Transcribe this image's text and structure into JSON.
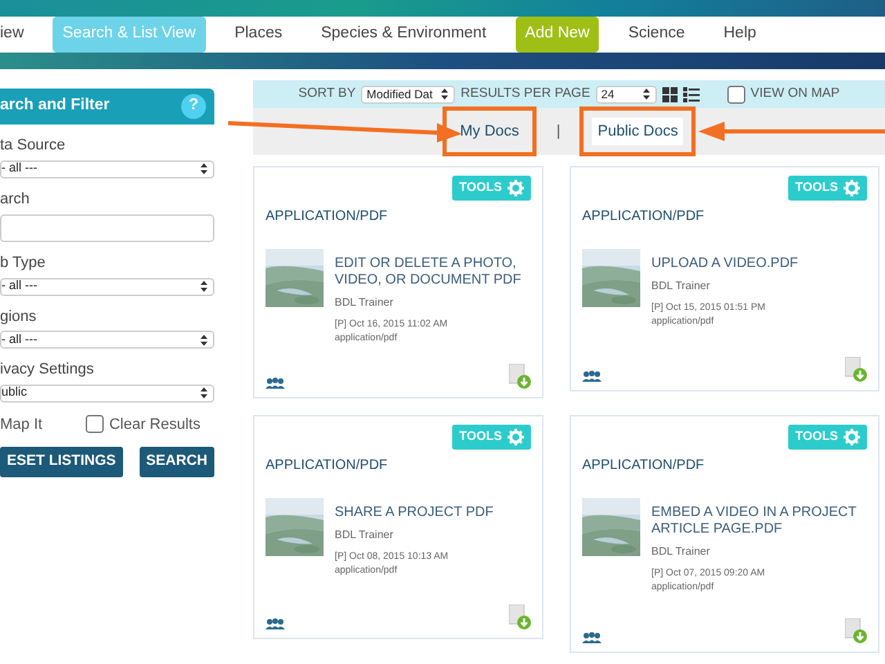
{
  "nav": {
    "items": [
      {
        "label": "iew",
        "kind": "link",
        "selected": false
      },
      {
        "label": "Search & List View",
        "kind": "link",
        "selected": true
      },
      {
        "label": "Places",
        "kind": "link",
        "selected": false
      },
      {
        "label": "Species & Environment",
        "kind": "link",
        "selected": false
      },
      {
        "label": "Add New",
        "kind": "action",
        "selected": false
      },
      {
        "label": "Science",
        "kind": "link",
        "selected": false
      },
      {
        "label": "Help",
        "kind": "link",
        "selected": false
      }
    ]
  },
  "sidebar": {
    "title": "arch and Filter",
    "help": "?",
    "fields": [
      {
        "kind": "select",
        "label": "ta Source",
        "value": "- all ---"
      },
      {
        "kind": "text",
        "label": "arch"
      },
      {
        "kind": "select",
        "label": "b Type",
        "value": "- all ---"
      },
      {
        "kind": "select",
        "label": "gions",
        "value": "- all ---"
      },
      {
        "kind": "select",
        "label": "ivacy Settings",
        "value": "ublic"
      }
    ],
    "checkboxes": [
      {
        "label": "Map It"
      },
      {
        "label": "Clear Results",
        "checked": false
      }
    ],
    "buttons": [
      "ESET LISTINGS",
      "SEARCH"
    ]
  },
  "toolbar": {
    "sort_label": "SORT BY",
    "sort_value": "Modified Dat",
    "per_page_label": "RESULTS PER PAGE",
    "per_page_value": "24",
    "view_on_map": {
      "label": "VIEW ON MAP",
      "checked": false
    }
  },
  "tabs": [
    {
      "label": "My Docs",
      "selected": false,
      "highlighted": true
    },
    {
      "label": "Public Docs",
      "selected": true,
      "highlighted": true
    }
  ],
  "tab_separator": "|",
  "cards": [
    {
      "tools": "TOOLS",
      "type": "APPLICATION/PDF",
      "title": "EDIT OR DELETE A PHOTO, VIDEO, OR DOCUMENT PDF",
      "author": "BDL Trainer",
      "date": "[P] Oct 16, 2015 11:02 AM",
      "mime": "application/pdf"
    },
    {
      "tools": "TOOLS",
      "type": "APPLICATION/PDF",
      "title": "UPLOAD A VIDEO.PDF",
      "author": "BDL Trainer",
      "date": "[P] Oct 15, 2015 01:51 PM",
      "mime": "application/pdf"
    },
    {
      "tools": "TOOLS",
      "type": "APPLICATION/PDF",
      "title": "SHARE A PROJECT PDF",
      "author": "BDL Trainer",
      "date": "[P] Oct 08, 2015 10:13 AM",
      "mime": "application/pdf"
    },
    {
      "tools": "TOOLS",
      "type": "APPLICATION/PDF",
      "title": "EMBED A VIDEO IN A PROJECT ARTICLE PAGE.PDF",
      "author": "BDL Trainer",
      "date": "[P] Oct 07, 2015 09:20 AM",
      "mime": "application/pdf"
    }
  ]
}
